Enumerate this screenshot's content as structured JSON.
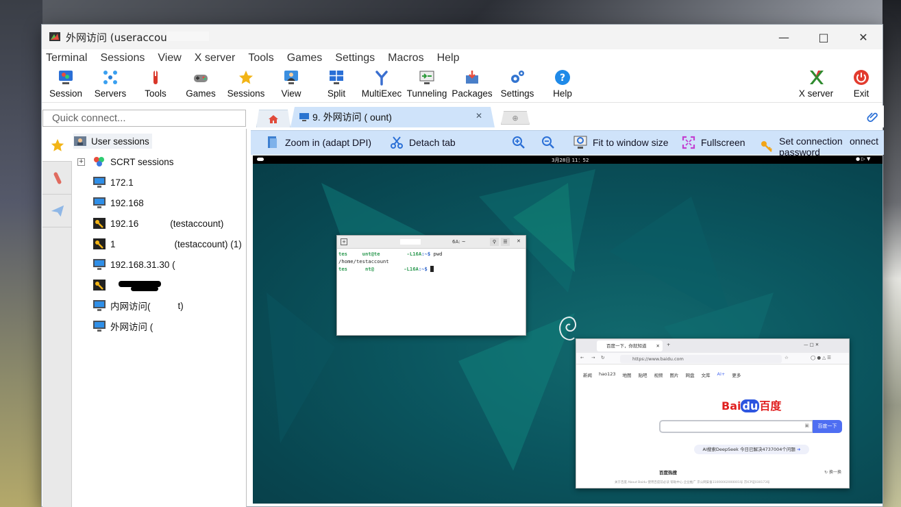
{
  "window": {
    "title": "外网访问 (useraccou"
  },
  "menu": [
    "Terminal",
    "Sessions",
    "View",
    "X server",
    "Tools",
    "Games",
    "Settings",
    "Macros",
    "Help"
  ],
  "toolbar": {
    "session": "Session",
    "servers": "Servers",
    "tools": "Tools",
    "games": "Games",
    "sessions": "Sessions",
    "view": "View",
    "split": "Split",
    "multiexec": "MultiExec",
    "tunneling": "Tunneling",
    "packages": "Packages",
    "settings": "Settings",
    "help": "Help",
    "xserver": "X server",
    "exit": "Exit"
  },
  "quick_connect": {
    "placeholder": "Quick connect..."
  },
  "tabs": {
    "active_label": "9. 外网访问 (                ount)"
  },
  "remote_toolbar": {
    "zoom_in": "Zoom in (adapt DPI)",
    "detach": "Detach tab",
    "fit": "Fit to window size",
    "fullscreen": "Fullscreen",
    "set_password": "Set connection password",
    "connect_partial": "onnect"
  },
  "sessions": {
    "user_sessions": "User sessions",
    "scrt_sessions": "SCRT sessions",
    "items": [
      "172.1",
      "192.168",
      "192.16",
      "1",
      "192.168.31.30 (",
      "",
      "内网访问(",
      "外网访问 ("
    ],
    "item3_suffix": "(testaccount)",
    "item4_mid": "(testaccount) (1)",
    "item7_suffix": "t)"
  },
  "remote": {
    "clock": "3月28日 11：52",
    "terminal": {
      "title": "6A: ~",
      "lines": [
        {
          "prompt": "tes     unt@te",
          "host": "         -L16A",
          "path": ":~$",
          "cmd": " pwd"
        },
        {
          "plain": "/home/testaccount"
        },
        {
          "prompt": "tes      nt@",
          "host": "          -L16A",
          "path": ":~$",
          "cmd": " "
        }
      ]
    },
    "browser": {
      "tab_title": "百度一下，你就知道",
      "url": "https://www.baidu.com",
      "nav": [
        "新闻",
        "hao123",
        "地图",
        "贴吧",
        "视频",
        "图片",
        "网盘",
        "文库",
        "AI+",
        "更多"
      ],
      "logo_red1": "Bai",
      "logo_blue": "du",
      "logo_red2": "百度",
      "search_button": "百度一下",
      "ai_banner": "AI搜索DeepSeek 今日已解决4737004个问题",
      "hot_title": "百度热搜",
      "swap": "换一换",
      "footer": "关于百度   About Baidu   使用百度前必读   帮助中心   企业推广   京公网安备11000002000001号   京ICP证030173号"
    }
  },
  "colors": {
    "accent": "#cfe3fa",
    "desktop": "#0b5760",
    "baidu_blue": "#4e6ef2",
    "baidu_red": "#e02020"
  }
}
